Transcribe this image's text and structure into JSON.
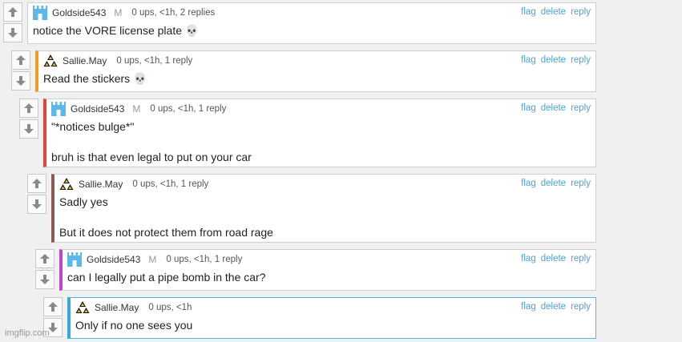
{
  "comments": [
    {
      "user": "Goldside543",
      "mod_badge": "M",
      "stats": "0 ups, <1h, 2 replies",
      "lines": [
        "notice the VORE license plate"
      ],
      "emoji": "💀",
      "actions": {
        "flag": "flag",
        "delete": "delete",
        "reply": "reply"
      },
      "avatar": "castle-avatar",
      "accent": "#3aa6dd"
    },
    {
      "user": "Sallie.May",
      "stats": "0 ups, <1h, 1 reply",
      "lines": [
        "Read the stickers"
      ],
      "emoji": "💀",
      "actions": {
        "flag": "flag",
        "delete": "delete",
        "reply": "reply"
      },
      "avatar": "triforce-avatar",
      "accent": "#f09a2a"
    },
    {
      "user": "Goldside543",
      "mod_badge": "M",
      "stats": "0 ups, <1h, 1 reply",
      "lines": [
        "\"*notices bulge*\"",
        "bruh is that even legal to put on your car"
      ],
      "actions": {
        "flag": "flag",
        "delete": "delete",
        "reply": "reply"
      },
      "avatar": "castle-avatar",
      "accent": "#e0473b"
    },
    {
      "user": "Sallie.May",
      "stats": "0 ups, <1h, 1 reply",
      "lines": [
        "Sadly yes",
        "But it does not protect them from road rage"
      ],
      "actions": {
        "flag": "flag",
        "delete": "delete",
        "reply": "reply"
      },
      "avatar": "triforce-avatar",
      "accent": "#8b5a52"
    },
    {
      "user": "Goldside543",
      "mod_badge": "M",
      "stats": "0 ups, <1h, 1 reply",
      "lines": [
        "can I legally put a pipe bomb in the car?"
      ],
      "actions": {
        "flag": "flag",
        "delete": "delete",
        "reply": "reply"
      },
      "avatar": "castle-avatar",
      "accent": "#c046c8"
    },
    {
      "user": "Sallie.May",
      "stats": "0 ups, <1h",
      "lines": [
        "Only if no one sees you"
      ],
      "actions": {
        "flag": "flag",
        "delete": "delete",
        "reply": "reply"
      },
      "avatar": "triforce-avatar",
      "accent": "#3aa6dd"
    }
  ],
  "icons": {
    "upvote": "up-arrow-icon",
    "downvote": "down-arrow-icon"
  },
  "watermark": "imgflip.com"
}
